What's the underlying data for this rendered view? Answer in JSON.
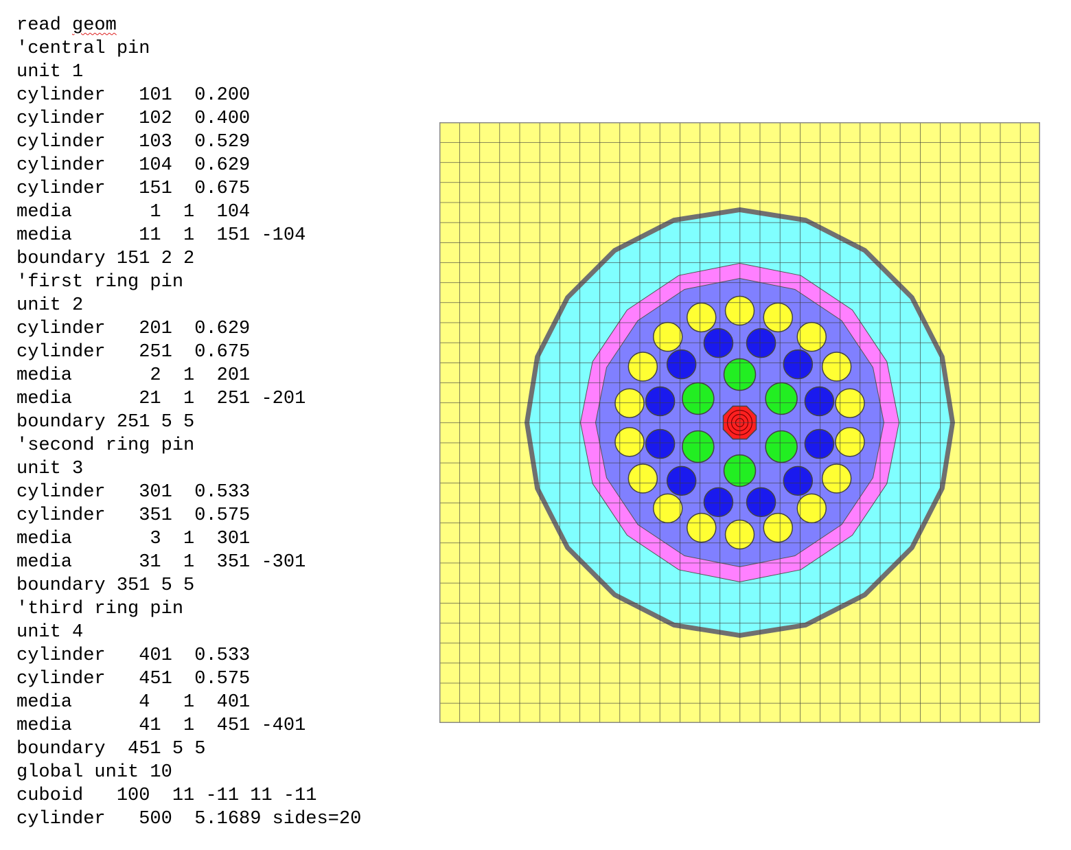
{
  "code_lines": [
    "read geom",
    "'central pin",
    "unit 1",
    "cylinder   101  0.200",
    "cylinder   102  0.400",
    "cylinder   103  0.529",
    "cylinder   104  0.629",
    "cylinder   151  0.675",
    "media       1  1  104",
    "media      11  1  151 -104",
    "boundary 151 2 2",
    "'first ring pin",
    "unit 2",
    "cylinder   201  0.629",
    "cylinder   251  0.675",
    "media       2  1  201",
    "media      21  1  251 -201",
    "boundary 251 5 5",
    "'second ring pin",
    "unit 3",
    "cylinder   301  0.533",
    "cylinder   351  0.575",
    "media       3  1  301",
    "media      31  1  351 -301",
    "boundary 351 5 5",
    "'third ring pin",
    "unit 4",
    "cylinder   401  0.533",
    "cylinder   451  0.575",
    "media      4   1  401",
    "media      41  1  451 -401",
    "boundary  451 5 5",
    "global unit 10",
    "cuboid   100  11 -11 11 -11",
    "cylinder   500  5.1689 sides=20"
  ],
  "spellcheck_word": "geom",
  "diagram": {
    "grid_cells": 30,
    "colors": {
      "background": "#ffff80",
      "grid": "#3a3a3a",
      "outer_ring": "#707070",
      "water": "#80ffff",
      "pink_ring": "#ff80ff",
      "inner_body": "#8080ff",
      "ring3_pin": "#ffff33",
      "ring2_pin": "#1a1aee",
      "ring1_pin": "#22ee22",
      "center_pin": "#ff2020"
    },
    "rings": [
      {
        "name": "ring-1",
        "count": 6,
        "color_key": "ring1_pin"
      },
      {
        "name": "ring-2",
        "count": 12,
        "color_key": "ring2_pin"
      },
      {
        "name": "ring-3",
        "count": 18,
        "color_key": "ring3_pin"
      }
    ]
  }
}
